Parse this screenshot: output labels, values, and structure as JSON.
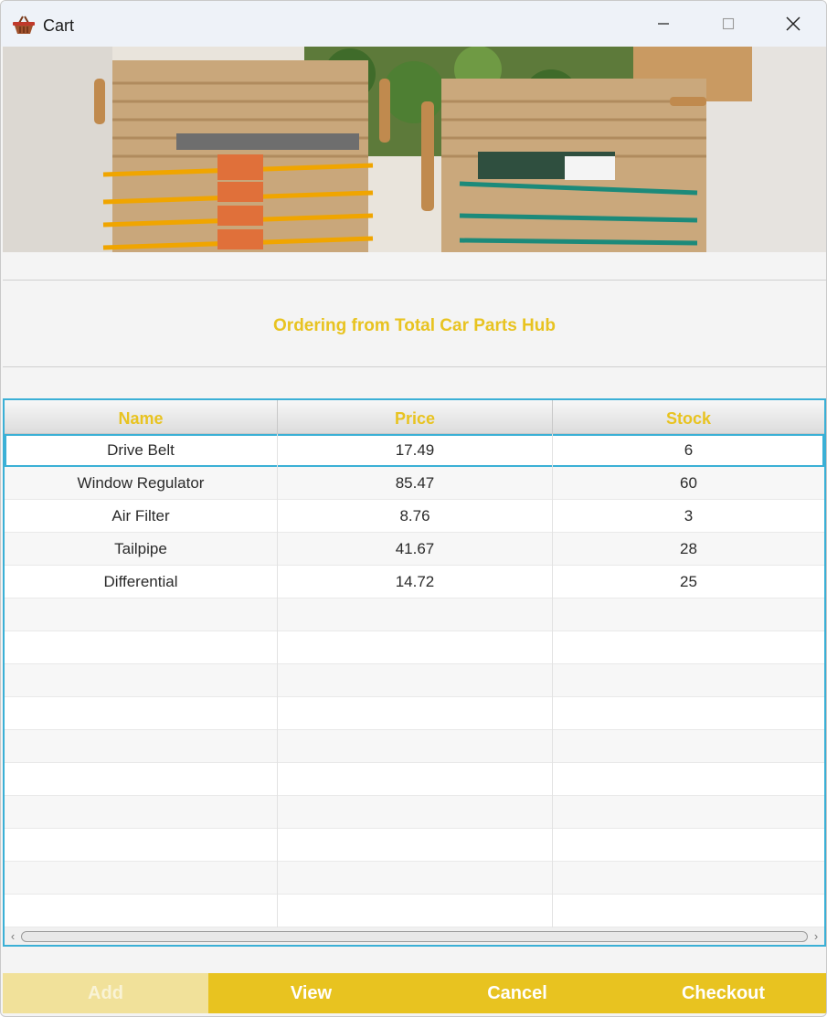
{
  "window": {
    "title": "Cart",
    "app_icon": "basket-icon",
    "controls": [
      "minimize-icon",
      "maximize-icon",
      "close-icon"
    ]
  },
  "banner": {
    "image": "shopping-baskets-photo"
  },
  "header": {
    "store_title": "Ordering from Total Car Parts Hub"
  },
  "table": {
    "columns": [
      "Name",
      "Price",
      "Stock"
    ],
    "rows": [
      [
        "Drive Belt",
        "17.49",
        "6"
      ],
      [
        "Window Regulator",
        "85.47",
        "60"
      ],
      [
        "Air Filter",
        "8.76",
        "3"
      ],
      [
        "Tailpipe",
        "41.67",
        "28"
      ],
      [
        "Differential",
        "14.72",
        "25"
      ]
    ],
    "selected_row": 0,
    "empty_rows": 10
  },
  "footer": {
    "add_label": "Add",
    "view_label": "View",
    "cancel_label": "Cancel",
    "checkout_label": "Checkout"
  },
  "colors": {
    "accent": "#e8c320",
    "selection": "#3bb0d6",
    "disabled": "#f1e19a"
  }
}
